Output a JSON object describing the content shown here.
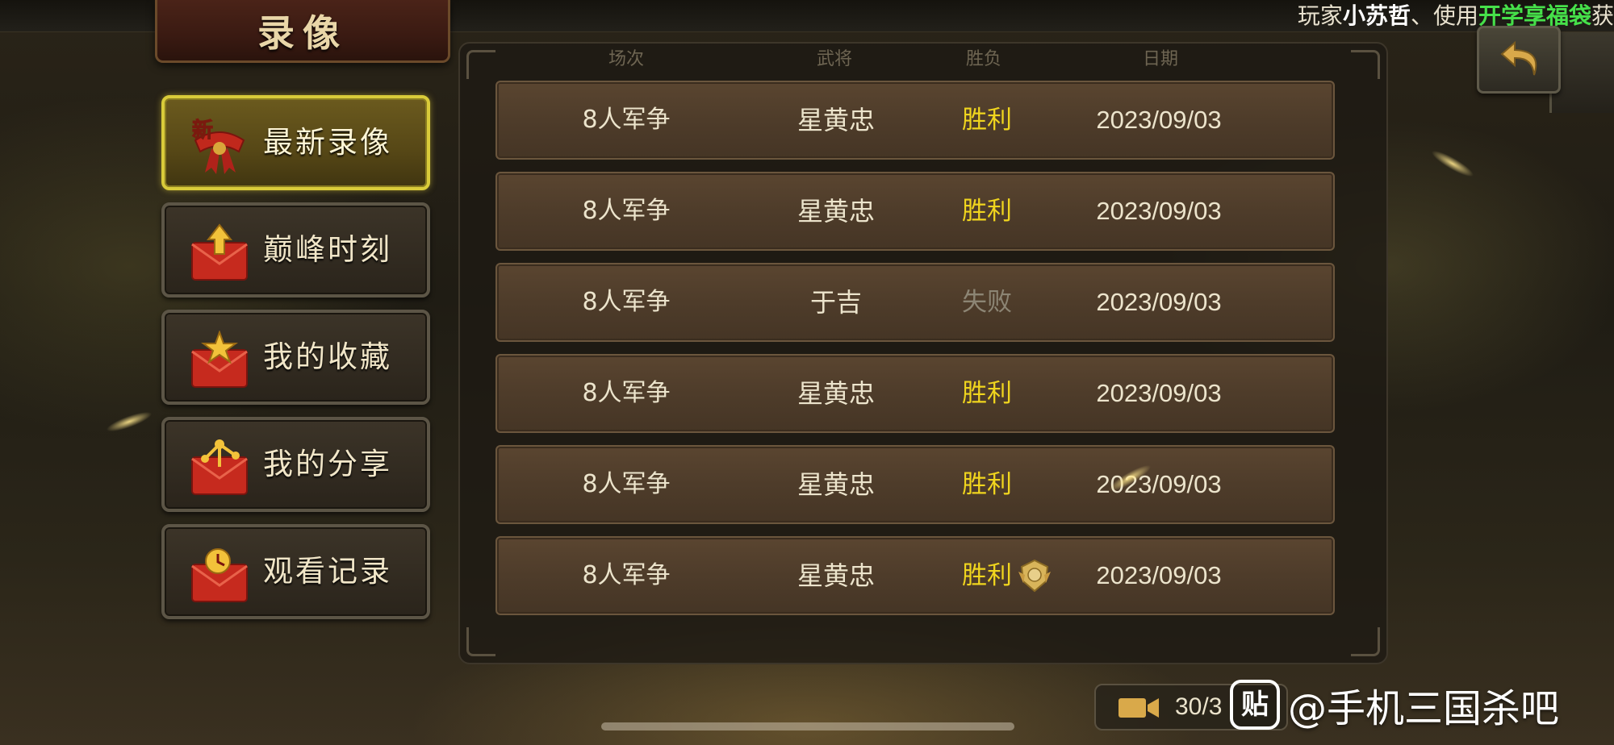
{
  "marquee": {
    "prefix": "玩家",
    "player": "小苏哲",
    "middle": "、使用",
    "item": "开学享福袋",
    "suffix": "获"
  },
  "title": "录像",
  "menu": [
    {
      "label": "最新录像",
      "icon": "new-ribbon-icon",
      "active": true
    },
    {
      "label": "巅峰时刻",
      "icon": "red-envelope-arrow-icon",
      "active": false
    },
    {
      "label": "我的收藏",
      "icon": "red-envelope-star-icon",
      "active": false
    },
    {
      "label": "我的分享",
      "icon": "red-envelope-share-icon",
      "active": false
    },
    {
      "label": "观看记录",
      "icon": "red-envelope-history-icon",
      "active": false
    }
  ],
  "table": {
    "headers": {
      "mode": "场次",
      "hero": "武将",
      "result": "胜负",
      "date": "日期"
    },
    "rows": [
      {
        "mode": "8人军争",
        "hero": "星黄忠",
        "result": "胜利",
        "date": "2023/09/03"
      },
      {
        "mode": "8人军争",
        "hero": "星黄忠",
        "result": "胜利",
        "date": "2023/09/03"
      },
      {
        "mode": "8人军争",
        "hero": "于吉",
        "result": "失败",
        "date": "2023/09/03"
      },
      {
        "mode": "8人军争",
        "hero": "星黄忠",
        "result": "胜利",
        "date": "2023/09/03"
      },
      {
        "mode": "8人军争",
        "hero": "星黄忠",
        "result": "胜利",
        "date": "2023/09/03"
      },
      {
        "mode": "8人军争",
        "hero": "星黄忠",
        "result": "胜利",
        "date": "2023/09/03"
      }
    ]
  },
  "counter": {
    "text": "30/3"
  },
  "watermark": {
    "logo": "贴",
    "text": "@手机三国杀吧"
  },
  "colors": {
    "win": "#f0d51e",
    "lose": "#8c8574",
    "active_border": "#d9cb3a",
    "marquee_item": "#46e04a"
  }
}
